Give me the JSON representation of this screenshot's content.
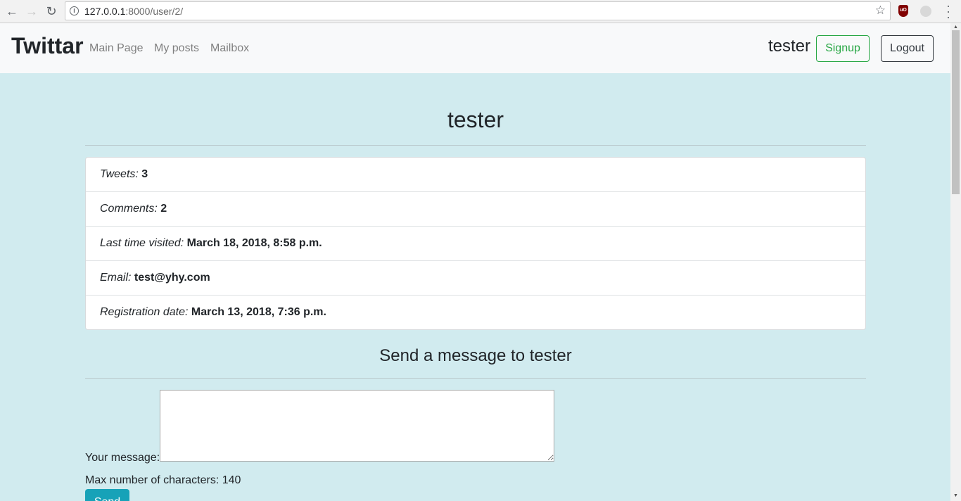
{
  "browser": {
    "url_host": "127.0.0.1",
    "url_rest": ":8000/user/2/"
  },
  "navbar": {
    "brand": "Twittar",
    "links": [
      "Main Page",
      "My posts",
      "Mailbox"
    ],
    "username": "tester",
    "signup_label": "Signup",
    "logout_label": "Logout"
  },
  "profile": {
    "title": "tester",
    "stats": [
      {
        "label": "Tweets:",
        "value": "3"
      },
      {
        "label": "Comments:",
        "value": "2"
      },
      {
        "label": "Last time visited:",
        "value": "March 18, 2018, 8:58 p.m."
      },
      {
        "label": "Email:",
        "value": "test@yhy.com"
      },
      {
        "label": "Registration date:",
        "value": "March 13, 2018, 7:36 p.m."
      }
    ]
  },
  "message": {
    "title": "Send a message to tester",
    "label": "Your message:",
    "textarea_value": "",
    "max_chars": "Max number of characters: 140",
    "send_label": "Send"
  },
  "colors": {
    "page_bg": "#d1ebef",
    "signup": "#28a745",
    "send": "#17a2b8"
  }
}
